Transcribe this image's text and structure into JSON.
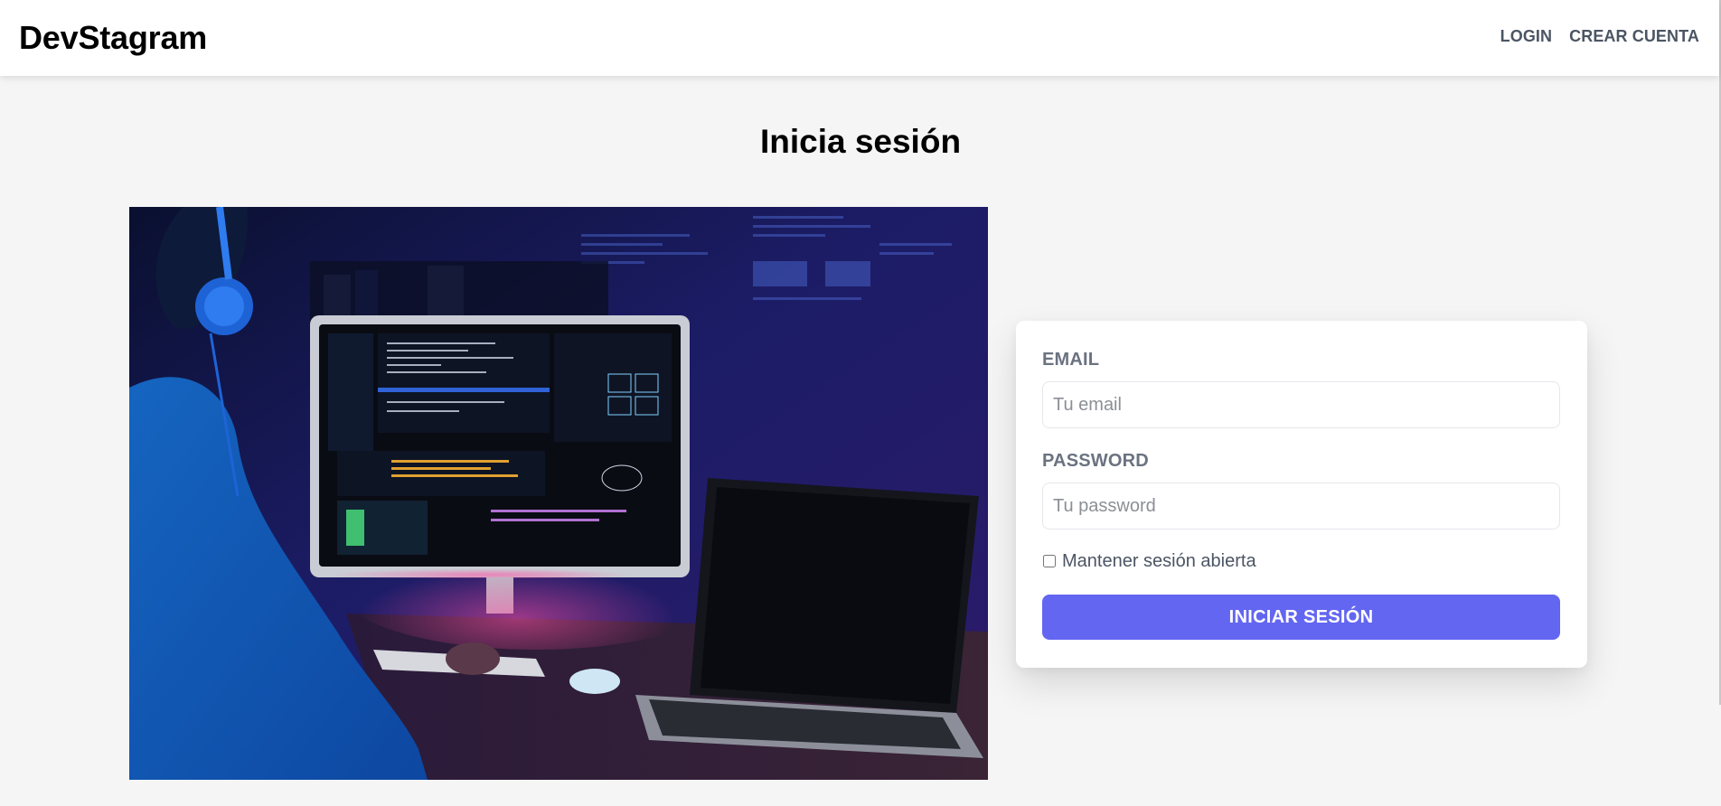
{
  "header": {
    "brand": "DevStagram",
    "nav": {
      "login": "LOGIN",
      "register": "CREAR CUENTA"
    }
  },
  "page": {
    "title": "Inicia sesión"
  },
  "form": {
    "email_label": "EMAIL",
    "email_placeholder": "Tu email",
    "email_value": "",
    "password_label": "PASSWORD",
    "password_placeholder": "Tu password",
    "password_value": "",
    "remember_label": "Mantener sesión abierta",
    "remember_checked": false,
    "submit_label": "INICIAR SESIÓN"
  },
  "colors": {
    "accent": "#6366f1",
    "nav_text": "#4b5563",
    "label_text": "#6b7280",
    "page_background": "#f5f5f5"
  }
}
